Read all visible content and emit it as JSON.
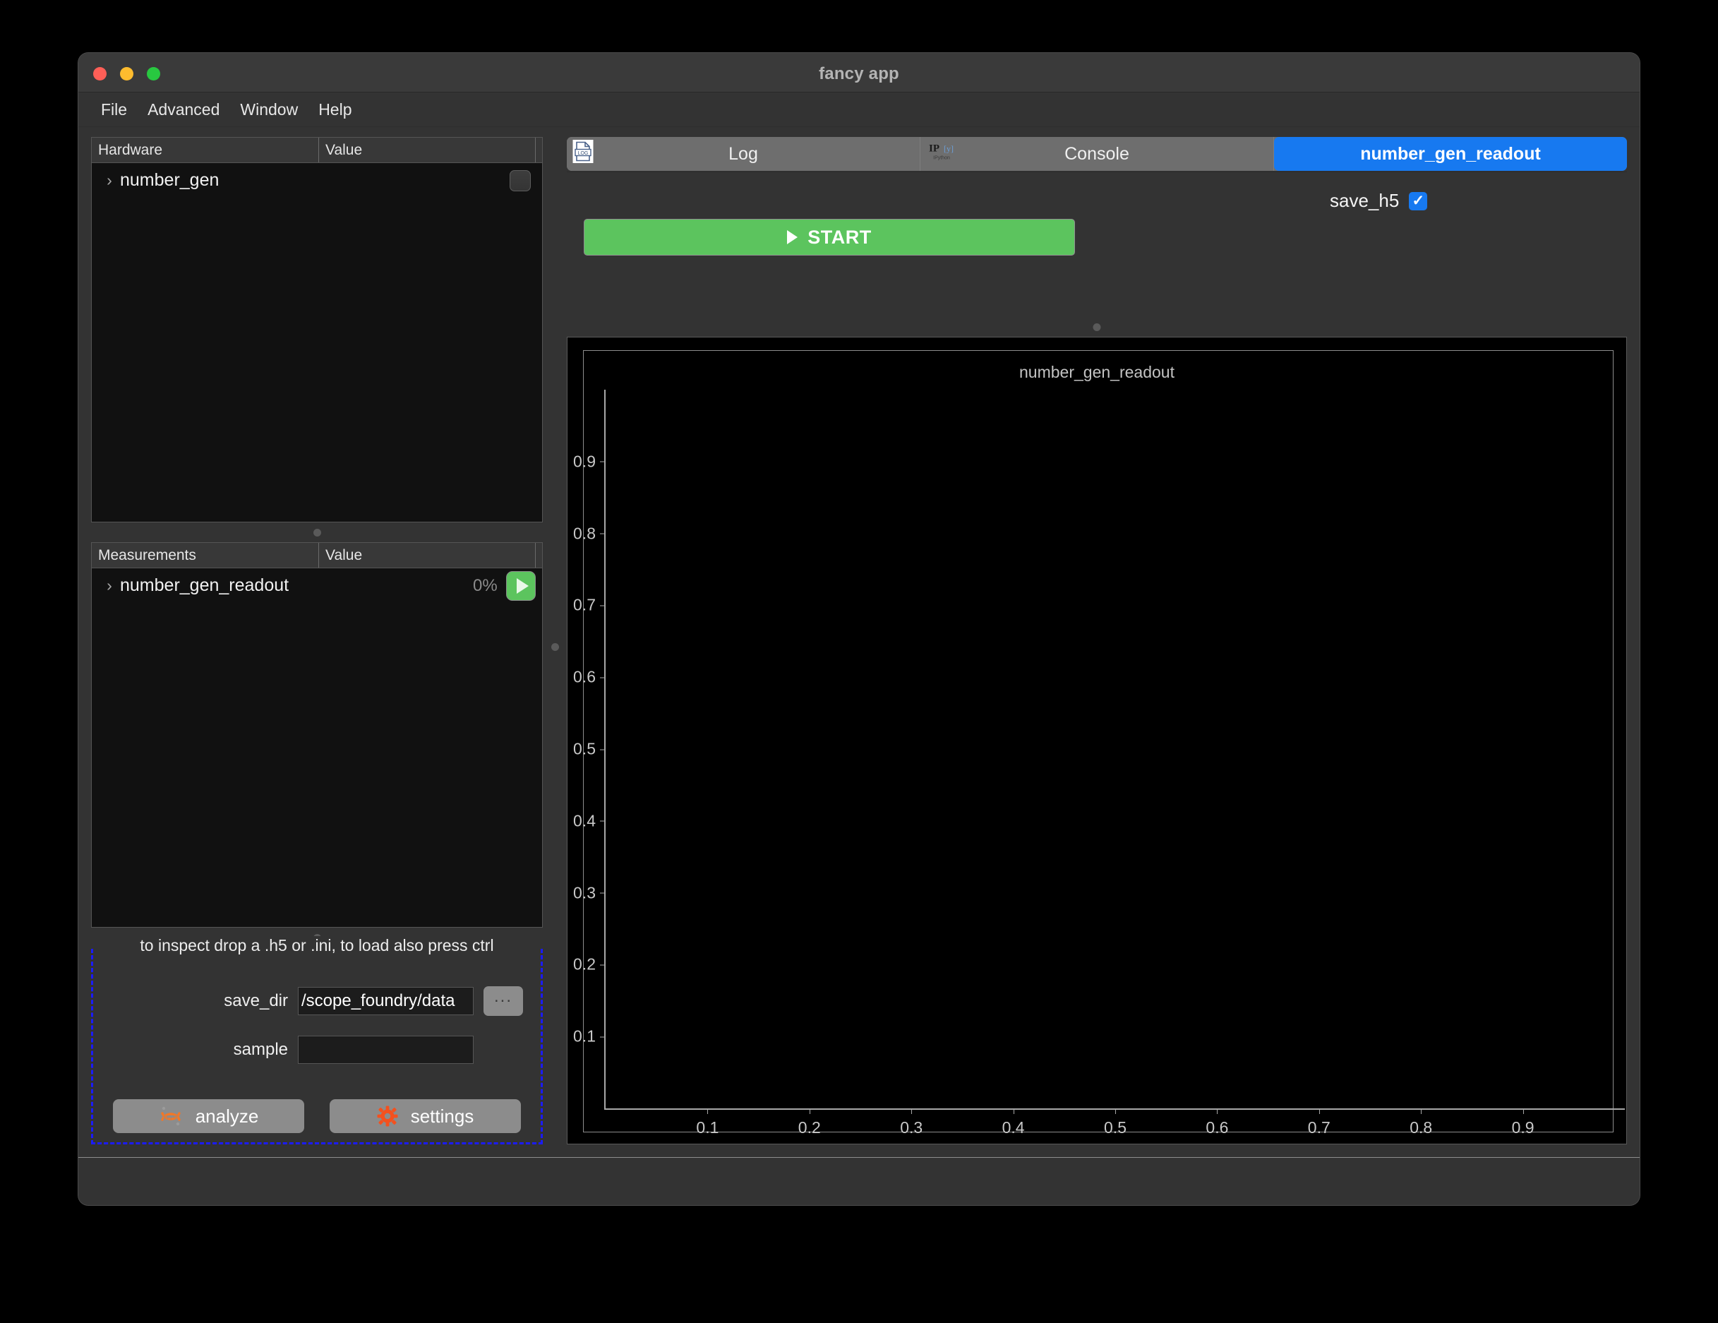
{
  "window": {
    "title": "fancy app",
    "traffic_lights": [
      "close",
      "minimize",
      "maximize"
    ]
  },
  "menubar": {
    "items": [
      {
        "label": "File"
      },
      {
        "label": "Advanced"
      },
      {
        "label": "Window"
      },
      {
        "label": "Help"
      }
    ]
  },
  "hardware_panel": {
    "columns": [
      "Hardware",
      "Value"
    ],
    "rows": [
      {
        "name": "number_gen",
        "value": "",
        "chevron": "›",
        "connected": false
      }
    ]
  },
  "measurements_panel": {
    "columns": [
      "Measurements",
      "Value"
    ],
    "rows": [
      {
        "name": "number_gen_readout",
        "value": "0%",
        "chevron": "›",
        "running": false
      }
    ]
  },
  "settings_panel": {
    "drop_hint": "to inspect drop a .h5 or .ini, to load also press ctrl",
    "fields": [
      {
        "label": "save_dir",
        "value": "/scope_foundry/data",
        "browse_label": "..."
      },
      {
        "label": "sample",
        "value": "",
        "placeholder": ""
      }
    ],
    "buttons": [
      {
        "label": "analyze",
        "icon": "jupyter-icon"
      },
      {
        "label": "settings",
        "icon": "gear-icon"
      }
    ],
    "border_color": "#1b1bff"
  },
  "tabs": [
    {
      "label": "Log",
      "icon": "log-document-icon",
      "active": false
    },
    {
      "label": "Console",
      "icon": "ipython-icon",
      "active": false
    },
    {
      "label": "number_gen_readout",
      "icon": "",
      "active": true
    }
  ],
  "controls": {
    "start_label": "START",
    "start_color": "#5cc45e",
    "save_h5_label": "save_h5",
    "save_h5_checked": true,
    "checkbox_color": "#1779f0",
    "check_glyph": "✓"
  },
  "chart_data": {
    "type": "line",
    "title": "number_gen_readout",
    "xlabel": "",
    "ylabel": "",
    "xlim": [
      0,
      1
    ],
    "ylim": [
      0,
      1
    ],
    "xticks": [
      "0.1",
      "0.2",
      "0.3",
      "0.4",
      "0.5",
      "0.6",
      "0.7",
      "0.8",
      "0.9"
    ],
    "yticks": [
      "0.1",
      "0.2",
      "0.3",
      "0.4",
      "0.5",
      "0.6",
      "0.7",
      "0.8",
      "0.9"
    ],
    "xtick_values": [
      0.1,
      0.2,
      0.3,
      0.4,
      0.5,
      0.6,
      0.7,
      0.8,
      0.9
    ],
    "ytick_values": [
      0.1,
      0.2,
      0.3,
      0.4,
      0.5,
      0.6,
      0.7,
      0.8,
      0.9
    ],
    "series": [],
    "grid": false,
    "legend": false,
    "background": "#000000",
    "axis_color": "#a8a8a8"
  }
}
